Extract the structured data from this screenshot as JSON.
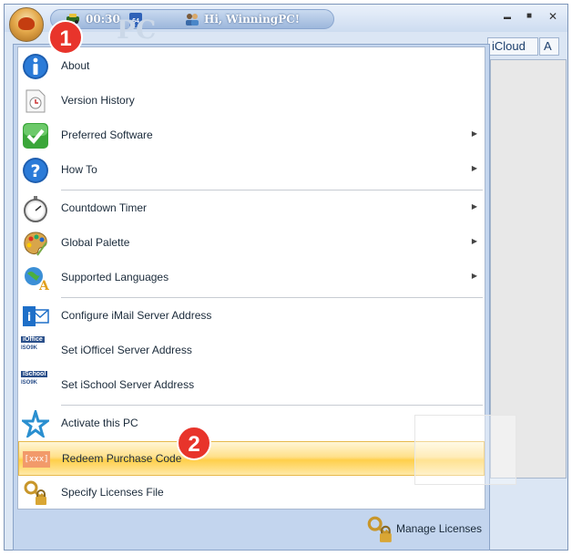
{
  "titlebar": {
    "time": "00:30",
    "bits_badge": "64",
    "greeting": "Hi, WinningPC!",
    "watermark_text": "PC",
    "minimize_glyph": "▬",
    "maximize_glyph": "■",
    "close_glyph": "✕"
  },
  "background_tabs": {
    "icloud": "iCloud",
    "a": "A"
  },
  "badges": {
    "one": "1",
    "two": "2"
  },
  "menu": {
    "items": [
      {
        "label": "About",
        "icon": "info-icon"
      },
      {
        "label": "Version History",
        "icon": "clock-document-icon"
      },
      {
        "label": "Preferred Software",
        "icon": "checkmark-icon"
      },
      {
        "label": "How To",
        "icon": "help-icon"
      },
      {
        "label": "Countdown Timer",
        "icon": "stopwatch-icon"
      },
      {
        "label": "Global Palette",
        "icon": "palette-icon"
      },
      {
        "label": "Supported Languages",
        "icon": "languages-icon"
      },
      {
        "label": "Configure iMail Server Address",
        "icon": "mail-icon"
      },
      {
        "label": "Set iOfficeI Server Address",
        "icon": "ioffice-icon"
      },
      {
        "label": "Set iSchool Server Address",
        "icon": "ischool-icon"
      },
      {
        "label": "Activate this PC",
        "icon": "star-icon"
      },
      {
        "label": "Redeem Purchase Code",
        "icon": "code-icon"
      },
      {
        "label": "Specify Licenses File",
        "icon": "key-lock-icon"
      }
    ],
    "ioffice_tag": "iOffice",
    "ischool_tag": "iSchool",
    "iso_tag": "ISO9K",
    "code_glyph": "[xxx]",
    "footer_label": "Manage Licenses",
    "highlight_color": "#ffd966"
  }
}
